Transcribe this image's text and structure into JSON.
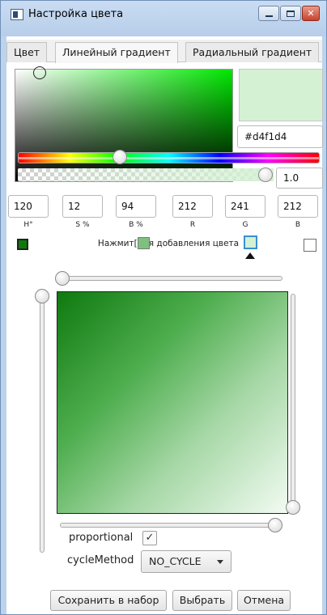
{
  "window": {
    "title": "Настройка цвета",
    "buttons": {
      "minimize": "minimize",
      "maximize": "maximize",
      "close": "✕"
    }
  },
  "tabs": [
    {
      "label": "Цвет",
      "active": false
    },
    {
      "label": "Линейный градиент",
      "active": true
    },
    {
      "label": "Радиальный градиент",
      "active": false
    }
  ],
  "color": {
    "hex": "#d4f1d4",
    "preview_color": "#d4f1d4",
    "alpha_value": "1.0",
    "hue_level": 0.33,
    "alpha_level": 1.0
  },
  "values": {
    "h": "120",
    "s": "12",
    "b": "94",
    "r": "212",
    "g": "241",
    "b_rgb": "212"
  },
  "labels": {
    "h": "H°",
    "s": "S %",
    "b": "B %",
    "r": "R",
    "g": "G",
    "b_rgb": "B"
  },
  "stops": {
    "left_color": "#0b7a0b",
    "mid_color": "#7fc07f",
    "selected_color": "#d4f1d4",
    "right_color": "#ffffff",
    "hint": "Нажмит[...]я добавления цвета"
  },
  "gradient": {
    "start_color": "#0f7a0f",
    "end_color": "#f2fbf2",
    "proportional_label": "proportional",
    "proportional_checked": "✓",
    "cycle_label": "cycleMethod",
    "cycle_value": "NO_CYCLE"
  },
  "footer": {
    "save_label": "Сохранить в набор",
    "choose_label": "Выбрать",
    "cancel_label": "Отмена"
  },
  "icons": {
    "app": "window-app-icon",
    "dropdown": "chevron-down-icon",
    "check": "check-icon",
    "pointer": "triangle-up-icon"
  }
}
